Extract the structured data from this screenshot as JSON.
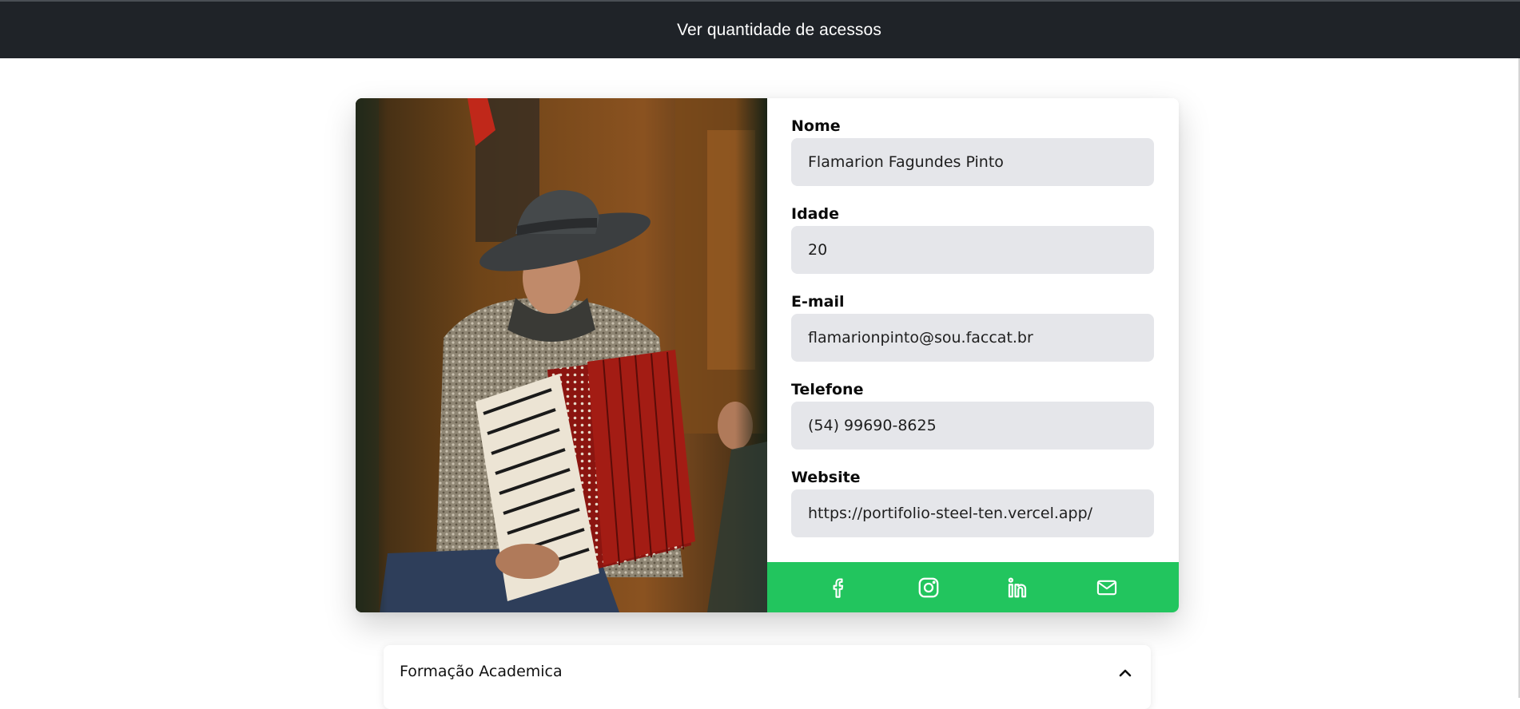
{
  "header": {
    "link_label": "Ver quantidade de acessos"
  },
  "profile": {
    "photo_alt": "Foto de perfil tocando acordeão",
    "fields": [
      {
        "label": "Nome",
        "value": "Flamarion Fagundes Pinto"
      },
      {
        "label": "Idade",
        "value": "20"
      },
      {
        "label": "E-mail",
        "value": "flamarionpinto@sou.faccat.br"
      },
      {
        "label": "Telefone",
        "value": "(54) 99690-8625"
      },
      {
        "label": "Website",
        "value": "https://portifolio-steel-ten.vercel.app/"
      }
    ]
  },
  "social": {
    "background": "#22c55e",
    "icons": [
      "facebook-icon",
      "instagram-icon",
      "linkedin-icon",
      "mail-icon"
    ]
  },
  "accordion": {
    "title": "Formação Academica",
    "state": "expanded"
  },
  "colors": {
    "topbar": "#1f2328",
    "input_bg": "#e5e6ea",
    "accent_green": "#22c55e"
  }
}
